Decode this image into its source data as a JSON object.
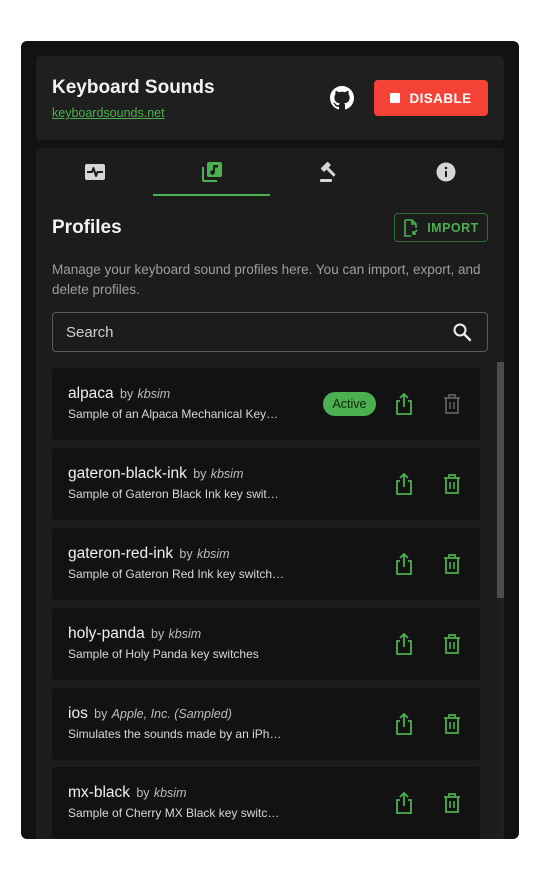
{
  "header": {
    "title": "Keyboard Sounds",
    "link": "keyboardsounds.net",
    "disable_label": "DISABLE"
  },
  "tabs": [
    {
      "icon": "pulse-icon",
      "active": false
    },
    {
      "icon": "music-library-icon",
      "active": true
    },
    {
      "icon": "gavel-icon",
      "active": false
    },
    {
      "icon": "info-icon",
      "active": false
    }
  ],
  "profiles": {
    "title": "Profiles",
    "import_label": "IMPORT",
    "description": "Manage your keyboard sound profiles here. You can import, export, and delete profiles.",
    "search_placeholder": "Search",
    "items": [
      {
        "name": "alpaca",
        "by": "by",
        "author": "kbsim",
        "description": "Sample of an Alpaca Mechanical Key…",
        "status": "Active",
        "deletable": false
      },
      {
        "name": "gateron-black-ink",
        "by": "by",
        "author": "kbsim",
        "description": "Sample of Gateron Black Ink key swit…",
        "status": "",
        "deletable": true
      },
      {
        "name": "gateron-red-ink",
        "by": "by",
        "author": "kbsim",
        "description": "Sample of Gateron Red Ink key switch…",
        "status": "",
        "deletable": true
      },
      {
        "name": "holy-panda",
        "by": "by",
        "author": "kbsim",
        "description": "Sample of Holy Panda key switches",
        "status": "",
        "deletable": true
      },
      {
        "name": "ios",
        "by": "by",
        "author": "Apple, Inc. (Sampled)",
        "description": "Simulates the sounds made by an iPh…",
        "status": "",
        "deletable": true
      },
      {
        "name": "mx-black",
        "by": "by",
        "author": "kbsim",
        "description": "Sample of Cherry MX Black key switc…",
        "status": "",
        "deletable": true
      }
    ]
  },
  "colors": {
    "accent": "#4caf50",
    "danger": "#f44336",
    "background": "#121212",
    "surface": "#1c1c1c"
  }
}
